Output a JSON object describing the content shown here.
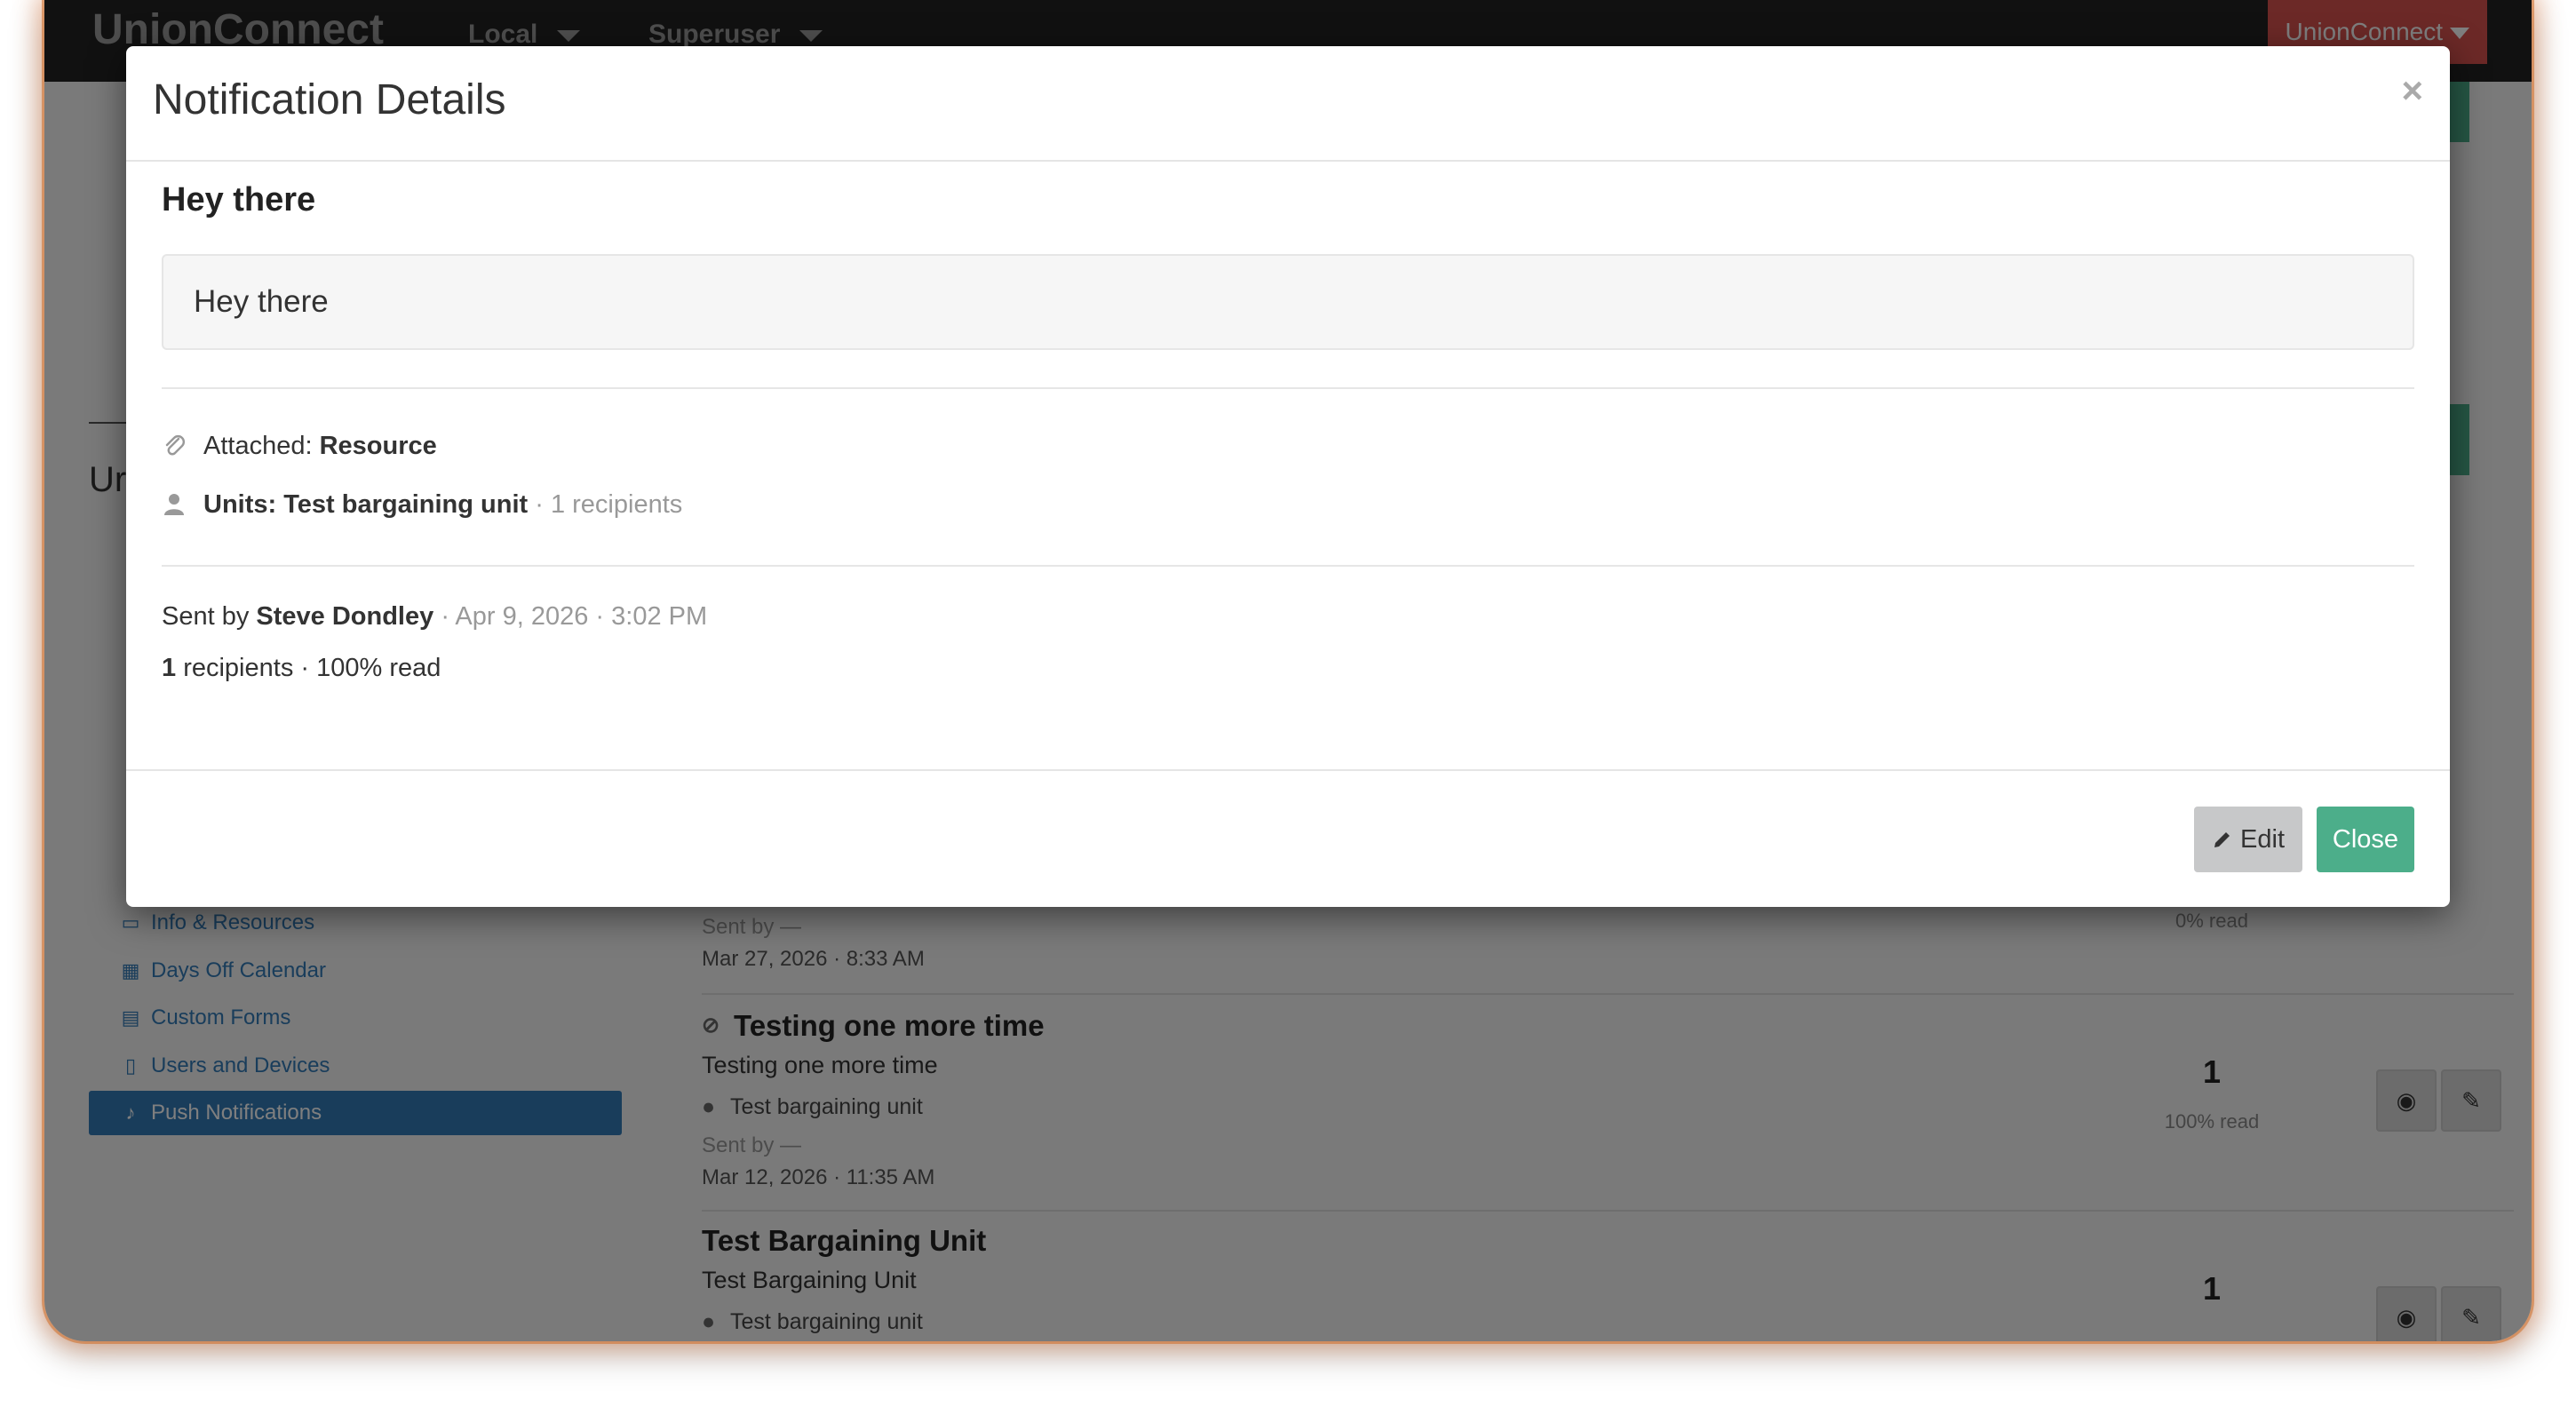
{
  "background": {
    "brand": "UnionConnect",
    "nav_local": "Local",
    "nav_superuser": "Superuser",
    "nav_user": "UnionConnect",
    "sidebar": [
      {
        "label": "Info & Resources",
        "icon": "folder-icon"
      },
      {
        "label": "Days Off Calendar",
        "icon": "calendar-icon"
      },
      {
        "label": "Custom Forms",
        "icon": "form-icon"
      },
      {
        "label": "Users and Devices",
        "icon": "device-icon"
      },
      {
        "label": "Push Notifications",
        "icon": "bell-icon",
        "active": true
      }
    ],
    "partial_heading": "Ur",
    "rows": [
      {
        "sent": "Sent by —",
        "date": "Mar 27, 2026 · 8:33 AM",
        "read": "0% read"
      },
      {
        "title": "Testing one more time",
        "body": "Testing one more time",
        "unit": "Test bargaining unit",
        "sent": "Sent by —",
        "date": "Mar 12, 2026 · 11:35 AM",
        "count": "1",
        "read": "100% read"
      },
      {
        "title": "Test Bargaining Unit",
        "body": "Test Bargaining Unit",
        "unit": "Test bargaining unit",
        "count": "1"
      }
    ]
  },
  "modal": {
    "title": "Notification Details",
    "close_symbol": "×",
    "message_title": "Hey there",
    "message_body": "Hey there",
    "attached_label": "Attached:",
    "attached_value": "Resource",
    "units_label": "Units: Test bargaining unit",
    "units_recipients": "· 1 recipients",
    "sent_prefix": "Sent by",
    "sent_by": "Steve Dondley",
    "sent_date": "· Apr 9, 2026 · 3:02 PM",
    "recipients_count": "1",
    "recipients_text": "recipients · 100% read",
    "edit_label": "Edit",
    "close_label": "Close"
  },
  "colors": {
    "accent_green": "#4cae8a",
    "nav_red": "#d9534f",
    "edit_gray": "#c7c8c9"
  }
}
